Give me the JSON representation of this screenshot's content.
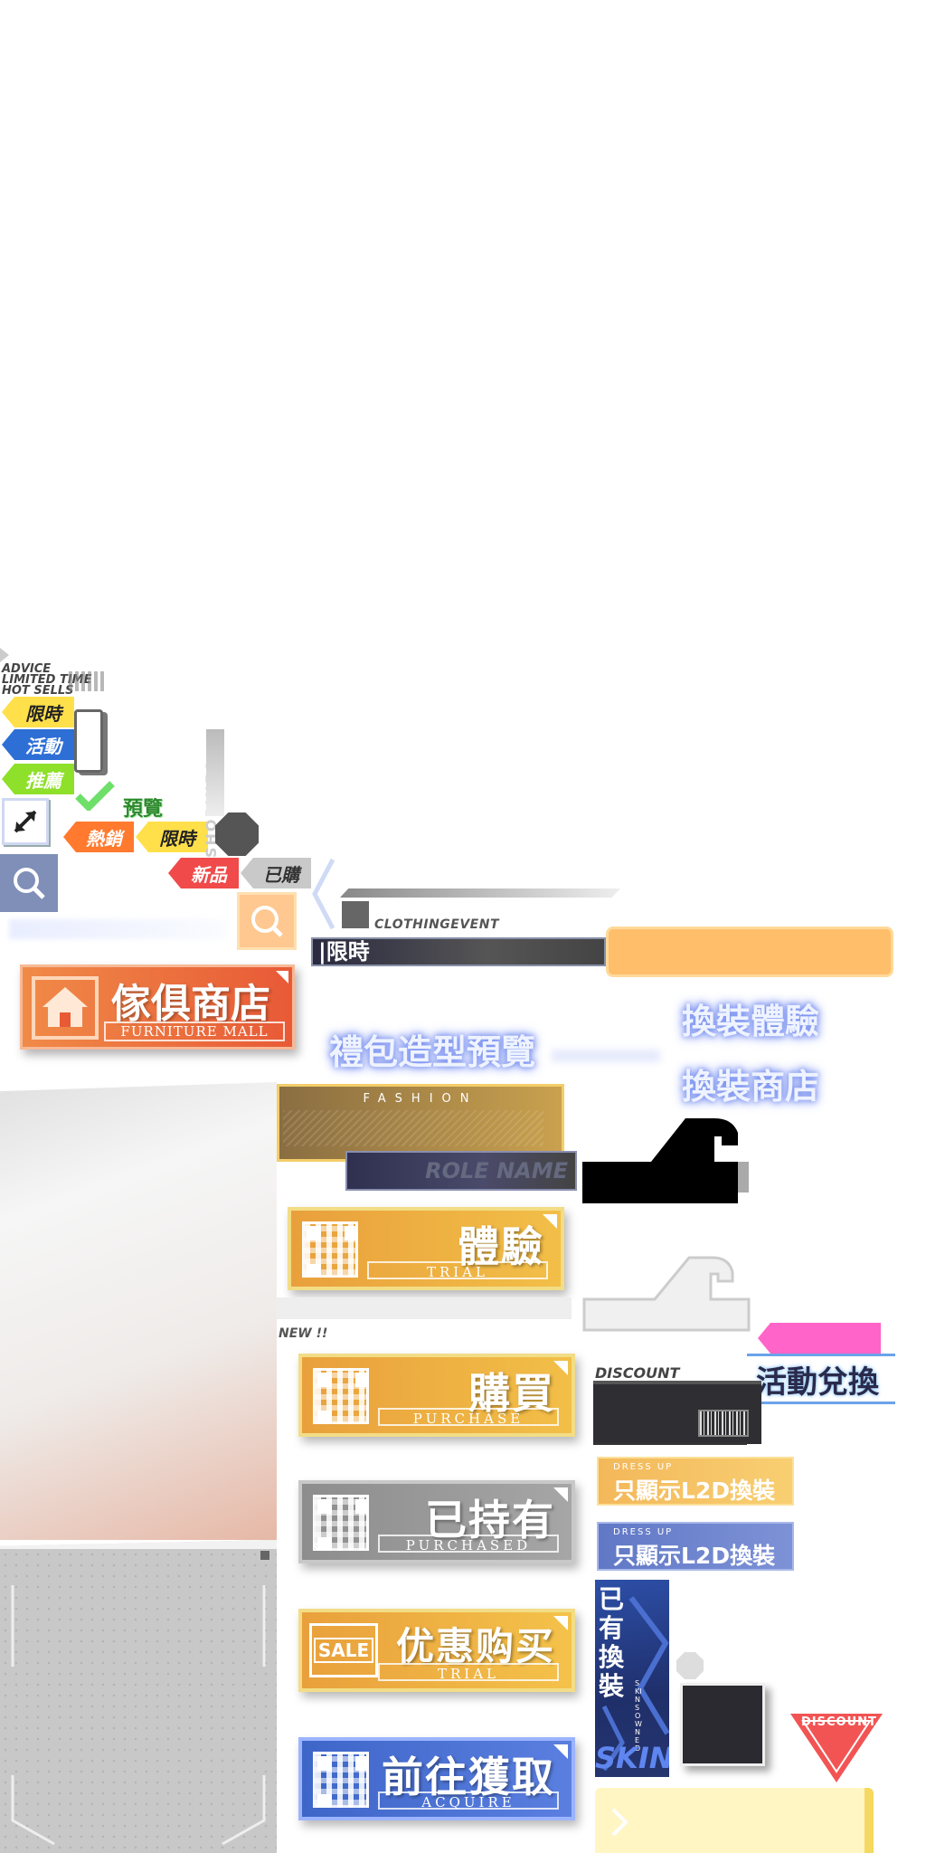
{
  "left_icons": {
    "label_advice": "ADVICE",
    "label_limited": "LIMITED TIME",
    "label_hot": "HOT SELLS",
    "tag_limited": "限時",
    "tag_event": "活動",
    "tag_recommend": "推薦",
    "preview_label": "預覽",
    "tag_hot": "熱銷",
    "tag_limited2": "限時",
    "tag_new": "新品",
    "tag_bought": "已購",
    "shop_info": "SHOPINFO",
    "icon_expand": "expand-arrows-icon",
    "icon_search": "search-icon",
    "icon_check": "check-icon"
  },
  "top_banner": {
    "clothing_event": "CLOTHINGEVENT",
    "limited_label": "|限時"
  },
  "furniture_button": {
    "main": "傢俱商店",
    "sub": "FURNITURE MALL",
    "icon": "house-icon"
  },
  "glow_titles": {
    "gift_preview": "禮包造型預覽",
    "dress_trial": "換裝體驗",
    "dress_shop": "換裝商店"
  },
  "fashion_panel": {
    "fashion_label": "FASHION",
    "role_name": "ROLE NAME"
  },
  "new_label": "NEW !!",
  "buttons": [
    {
      "main": "體驗",
      "sub": "TRIAL",
      "style": "gold",
      "icon": "qr-code-icon"
    },
    {
      "main": "購買",
      "sub": "PURCHASE",
      "style": "gold",
      "icon": "qr-code-icon"
    },
    {
      "main": "已持有",
      "sub": "PURCHASED",
      "style": "gray",
      "icon": "qr-code-icon"
    },
    {
      "main": "优惠购买",
      "sub": "TRIAL",
      "style": "gold",
      "icon": "sale-tag-icon",
      "sale_label": "SALE"
    },
    {
      "main": "前往獲取",
      "sub": "ACQUIRE",
      "style": "blue",
      "icon": "qr-code-icon"
    }
  ],
  "discount_panel": {
    "discount_label": "DISCOUNT",
    "event_exchange": "活動兌換"
  },
  "l2d_buttons": [
    {
      "small": "DRESS UP",
      "big": "只顯示L2D換裝",
      "style": "gold"
    },
    {
      "small": "DRESS UP",
      "big": "只顯示L2D換裝",
      "style": "blue"
    }
  ],
  "owned_skin": {
    "vertical": "已有換裝",
    "small": "SKINS OWNED",
    "skins": "SKINS"
  },
  "discount_triangle": "DISCOUNT",
  "colors": {
    "gold": "#e8a93a",
    "orange": "#ef6a3a",
    "blue": "#3d6fd4",
    "gray": "#8f8f8f",
    "pink": "#ff64c8",
    "dark": "#2f2f33"
  }
}
